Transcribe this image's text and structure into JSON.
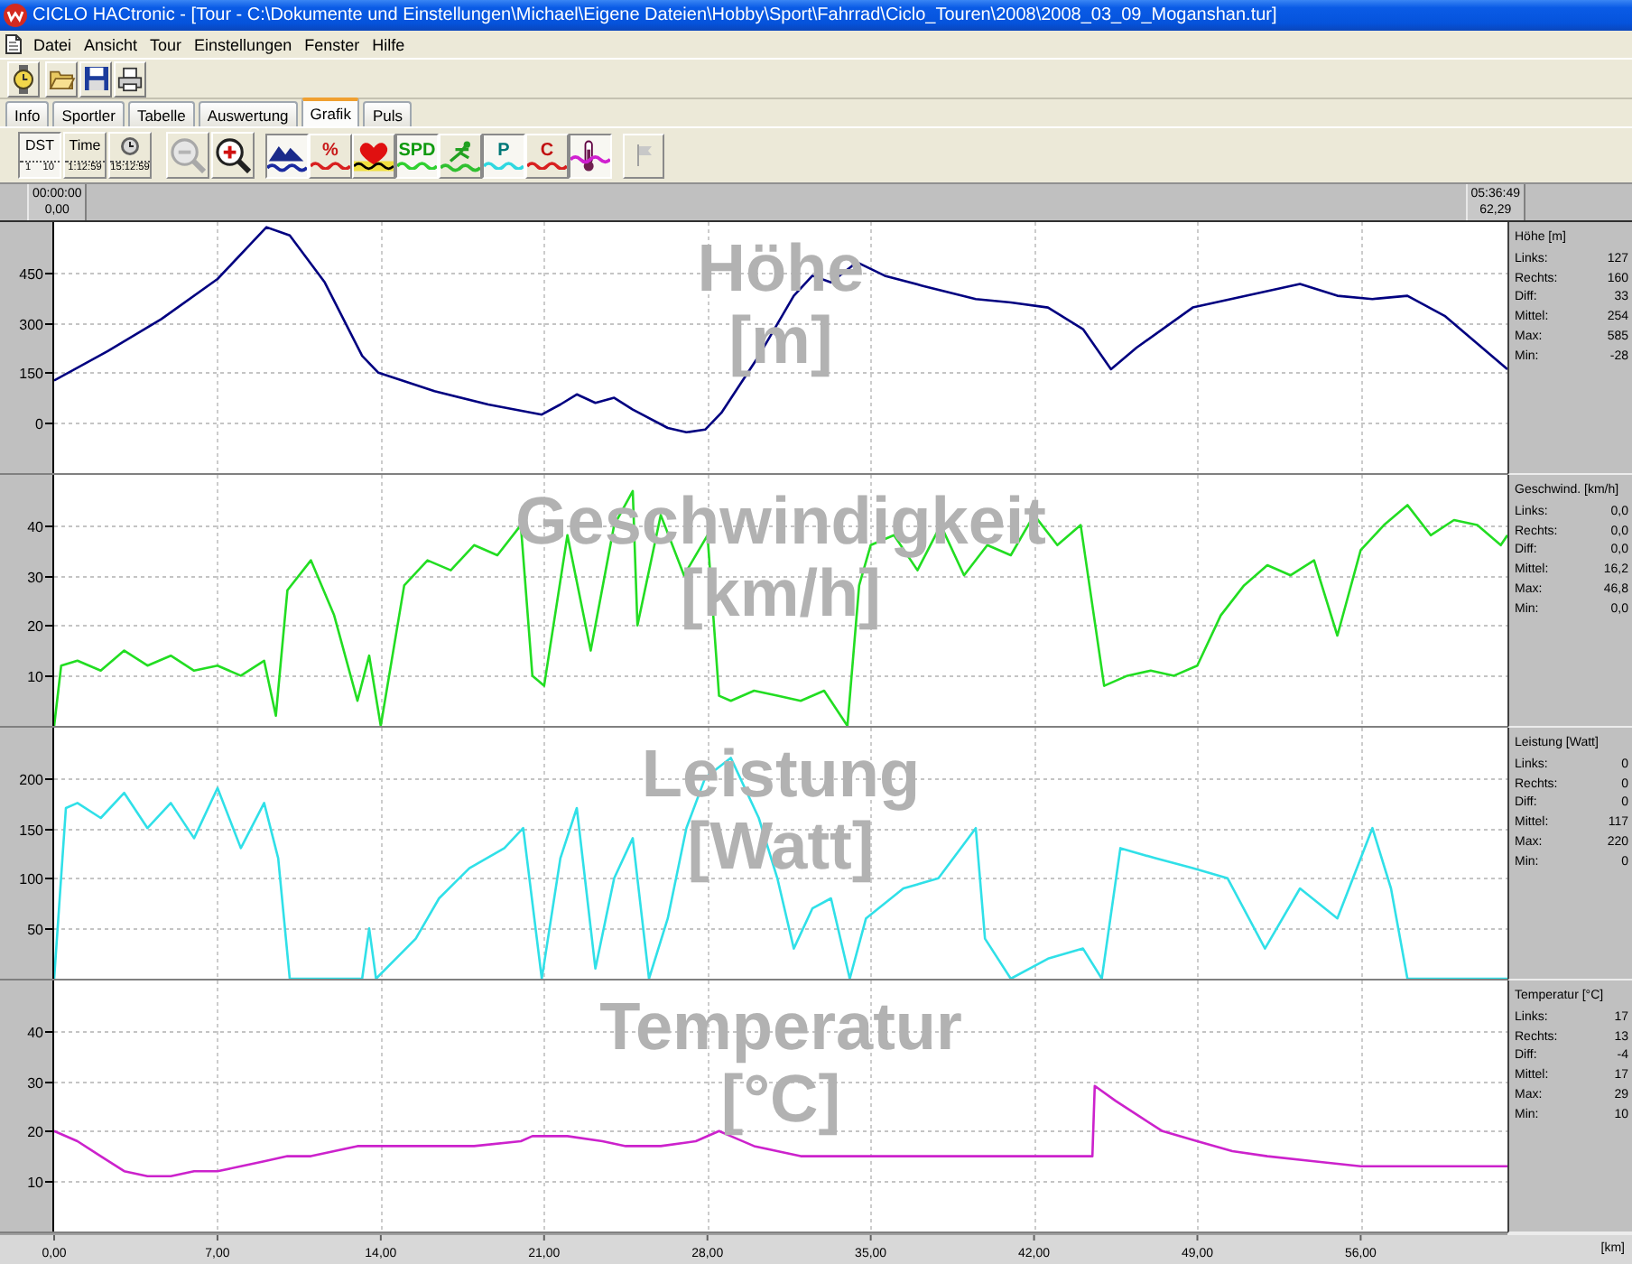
{
  "window": {
    "title": "CICLO HACtronic - [Tour - C:\\Dokumente und Einstellungen\\Michael\\Eigene Dateien\\Hobby\\Sport\\Fahrrad\\Ciclo_Touren\\2008\\2008_03_09_Moganshan.tur]"
  },
  "menu": [
    "Datei",
    "Ansicht",
    "Tour",
    "Einstellungen",
    "Fenster",
    "Hilfe"
  ],
  "tabs": [
    {
      "label": "Info",
      "selected": false
    },
    {
      "label": "Sportler",
      "selected": false
    },
    {
      "label": "Tabelle",
      "selected": false
    },
    {
      "label": "Auswertung",
      "selected": false
    },
    {
      "label": "Grafik",
      "selected": true
    },
    {
      "label": "Puls",
      "selected": false
    }
  ],
  "graph_toolbar": {
    "axis_buttons": [
      {
        "label": "DST",
        "reading": "1 10",
        "selected": true
      },
      {
        "label": "Time",
        "reading": "1:12:59",
        "selected": false
      },
      {
        "reading": "15:12:59",
        "selected": false
      }
    ],
    "zoom_buttons": [
      {
        "disabled": true
      },
      {
        "disabled": false
      }
    ],
    "chart_buttons": [
      {
        "pressed": true
      },
      {
        "label": "%",
        "pressed": false
      },
      {
        "pressed": false
      },
      {
        "label": "SPD",
        "pressed": true
      },
      {
        "pressed": false
      },
      {
        "label": "P",
        "pressed": true
      },
      {
        "label": "C",
        "pressed": false
      },
      {
        "pressed": true
      }
    ],
    "flag_button": {
      "disabled": true
    }
  },
  "range": {
    "start": {
      "time": "00:00:00",
      "distance": "0,00"
    },
    "end": {
      "time": "05:36:49",
      "distance": "62,29"
    }
  },
  "panels": [
    {
      "chart_data": {
        "type": "line",
        "title": "Höhe [m]",
        "grid": true,
        "x": [
          0,
          2.3,
          4.6,
          7,
          8.5,
          9.1,
          10.1,
          11.6,
          13.2,
          13.9,
          16.3,
          18.6,
          20.9,
          21.7,
          22.4,
          23.2,
          24,
          24.8,
          26.3,
          27.1,
          27.9,
          28.6,
          30.2,
          31.7,
          32.5,
          33.3,
          34.4,
          35.6,
          37.2,
          39.5,
          41,
          42.6,
          44.1,
          45.3,
          46.4,
          48.8,
          51.1,
          53.4,
          55,
          56.5,
          58,
          59.6,
          62.29
        ],
        "series": [
          {
            "color": "#000080",
            "values": [
              127,
              215,
              310,
              430,
              540,
              585,
              560,
              420,
              200,
              150,
              95,
              55,
              25,
              55,
              85,
              60,
              75,
              40,
              -15,
              -28,
              -20,
              30,
              200,
              380,
              440,
              420,
              480,
              440,
              410,
              370,
              360,
              345,
              280,
              160,
              225,
              345,
              380,
              415,
              380,
              370,
              380,
              320,
              160
            ]
          }
        ],
        "xlim": [
          0,
          62.29
        ],
        "ylim": [
          -150,
          600
        ],
        "yticks": [
          0,
          150,
          300,
          450
        ]
      },
      "stats": {
        "title": "Höhe [m]",
        "rows": [
          {
            "label": "Links:",
            "value": "127"
          },
          {
            "label": "Rechts:",
            "value": "160"
          },
          {
            "label": "Diff:",
            "value": "33"
          },
          {
            "label": "Mittel:",
            "value": "254"
          },
          {
            "label": "Max:",
            "value": "585"
          },
          {
            "label": "Min:",
            "value": "-28"
          }
        ]
      }
    },
    {
      "chart_data": {
        "type": "line",
        "title": "Geschwindigkeit [km/h]",
        "grid": true,
        "x": [
          0,
          0.3,
          1,
          2,
          3,
          4,
          5,
          6,
          7,
          8,
          9,
          9.5,
          10,
          11,
          12,
          13,
          13.5,
          14,
          15,
          16,
          17,
          18,
          19,
          20,
          20.5,
          21,
          22,
          23,
          24,
          24.8,
          25,
          26,
          27,
          28,
          28.5,
          29,
          30,
          31,
          32,
          33,
          34,
          34.5,
          35,
          36,
          37,
          38,
          39,
          40,
          41,
          42,
          43,
          44,
          45,
          46,
          47,
          48,
          49,
          50,
          51,
          52,
          53,
          54,
          55,
          56,
          57,
          58,
          59,
          60,
          61,
          62,
          62.29
        ],
        "series": [
          {
            "color": "#22dd22",
            "values": [
              0,
              12,
              13,
              11,
              15,
              12,
              14,
              11,
              12,
              10,
              13,
              2,
              27,
              33,
              22,
              5,
              14,
              0,
              28,
              33,
              31,
              36,
              34,
              40,
              10,
              8,
              38,
              15,
              40,
              46.8,
              20,
              42,
              30,
              38,
              6,
              5,
              7,
              6,
              5,
              7,
              0,
              28,
              36,
              38,
              31,
              40,
              30,
              36,
              34,
              42,
              36,
              40,
              8,
              10,
              11,
              10,
              12,
              22,
              28,
              32,
              30,
              33,
              18,
              35,
              40,
              44,
              38,
              41,
              40,
              36,
              38
            ]
          }
        ],
        "xlim": [
          0,
          62.29
        ],
        "ylim": [
          0,
          50
        ],
        "yticks": [
          10,
          20,
          30,
          40
        ]
      },
      "stats": {
        "title": "Geschwind. [km/h]",
        "rows": [
          {
            "label": "Links:",
            "value": "0,0"
          },
          {
            "label": "Rechts:",
            "value": "0,0"
          },
          {
            "label": "Diff:",
            "value": "0,0"
          },
          {
            "label": "Mittel:",
            "value": "16,2"
          },
          {
            "label": "Max:",
            "value": "46,8"
          },
          {
            "label": "Min:",
            "value": "0,0"
          }
        ]
      }
    },
    {
      "chart_data": {
        "type": "line",
        "title": "Leistung [Watt]",
        "grid": true,
        "x": [
          0,
          0.5,
          1,
          2,
          3,
          4,
          5,
          6,
          7,
          8,
          9,
          9.6,
          10.1,
          13.2,
          13.5,
          13.8,
          15.5,
          16.5,
          17.8,
          19.3,
          20.1,
          20.9,
          21.7,
          22.4,
          23.2,
          24,
          24.8,
          25.5,
          26.3,
          27.1,
          27.9,
          29,
          30.2,
          31,
          31.7,
          32.5,
          33.3,
          34.1,
          34.8,
          36.4,
          37.9,
          39.5,
          39.9,
          41,
          42.6,
          44.1,
          44.9,
          45.7,
          47.2,
          48.8,
          50.3,
          51.9,
          53.4,
          55,
          56.5,
          57.3,
          58,
          59.6,
          62.29
        ],
        "series": [
          {
            "color": "#30e0e8",
            "values": [
              0,
              170,
              175,
              160,
              185,
              150,
              175,
              140,
              190,
              130,
              175,
              120,
              0,
              0,
              50,
              0,
              40,
              80,
              110,
              130,
              150,
              0,
              120,
              170,
              10,
              100,
              140,
              0,
              60,
              150,
              200,
              220,
              160,
              100,
              30,
              70,
              80,
              0,
              60,
              90,
              100,
              150,
              40,
              0,
              20,
              30,
              0,
              130,
              120,
              110,
              100,
              30,
              90,
              60,
              150,
              90,
              0,
              0,
              0
            ]
          }
        ],
        "xlim": [
          0,
          62.29
        ],
        "ylim": [
          0,
          250
        ],
        "yticks": [
          50,
          100,
          150,
          200
        ]
      },
      "stats": {
        "title": "Leistung [Watt]",
        "rows": [
          {
            "label": "Links:",
            "value": "0"
          },
          {
            "label": "Rechts:",
            "value": "0"
          },
          {
            "label": "Diff:",
            "value": "0"
          },
          {
            "label": "Mittel:",
            "value": "117"
          },
          {
            "label": "Max:",
            "value": "220"
          },
          {
            "label": "Min:",
            "value": "0"
          }
        ]
      }
    },
    {
      "chart_data": {
        "type": "line",
        "title": "Temperatur [°C]",
        "grid": true,
        "x": [
          0,
          1,
          2,
          3,
          4,
          5,
          6,
          7,
          8,
          9,
          10,
          11,
          12,
          13,
          14,
          16,
          18,
          20,
          20.5,
          22,
          23.5,
          24.5,
          26,
          27.5,
          28.5,
          29,
          30,
          31,
          32,
          35,
          38,
          41,
          44.5,
          44.6,
          45.5,
          46.5,
          47.5,
          49,
          50.5,
          52,
          54,
          56,
          58,
          60,
          62.29
        ],
        "series": [
          {
            "color": "#cc22cc",
            "values": [
              20,
              18,
              15,
              12,
              11,
              11,
              12,
              12,
              13,
              14,
              15,
              15,
              16,
              17,
              17,
              17,
              17,
              18,
              19,
              19,
              18,
              17,
              17,
              18,
              20,
              19,
              17,
              16,
              15,
              15,
              15,
              15,
              15,
              29,
              26,
              23,
              20,
              18,
              16,
              15,
              14,
              13,
              13,
              13,
              13
            ]
          }
        ],
        "xlim": [
          0,
          62.29
        ],
        "ylim": [
          0,
          50
        ],
        "yticks": [
          10,
          20,
          30,
          40
        ],
        "xticks": [
          {
            "value": 0,
            "label": "0,00"
          },
          {
            "value": 7,
            "label": "7,00"
          },
          {
            "value": 14,
            "label": "14,00"
          },
          {
            "value": 21,
            "label": "21,00"
          },
          {
            "value": 28,
            "label": "28,00"
          },
          {
            "value": 35,
            "label": "35,00"
          },
          {
            "value": 42,
            "label": "42,00"
          },
          {
            "value": 49,
            "label": "49,00"
          },
          {
            "value": 56,
            "label": "56,00"
          }
        ]
      },
      "stats": {
        "title": "Temperatur [°C]",
        "rows": [
          {
            "label": "Links:",
            "value": "17"
          },
          {
            "label": "Rechts:",
            "value": "13"
          },
          {
            "label": "Diff:",
            "value": "-4"
          },
          {
            "label": "Mittel:",
            "value": "17"
          },
          {
            "label": "Max:",
            "value": "29"
          },
          {
            "label": "Min:",
            "value": "10"
          }
        ]
      }
    }
  ],
  "x_axis_unit": "[km]"
}
